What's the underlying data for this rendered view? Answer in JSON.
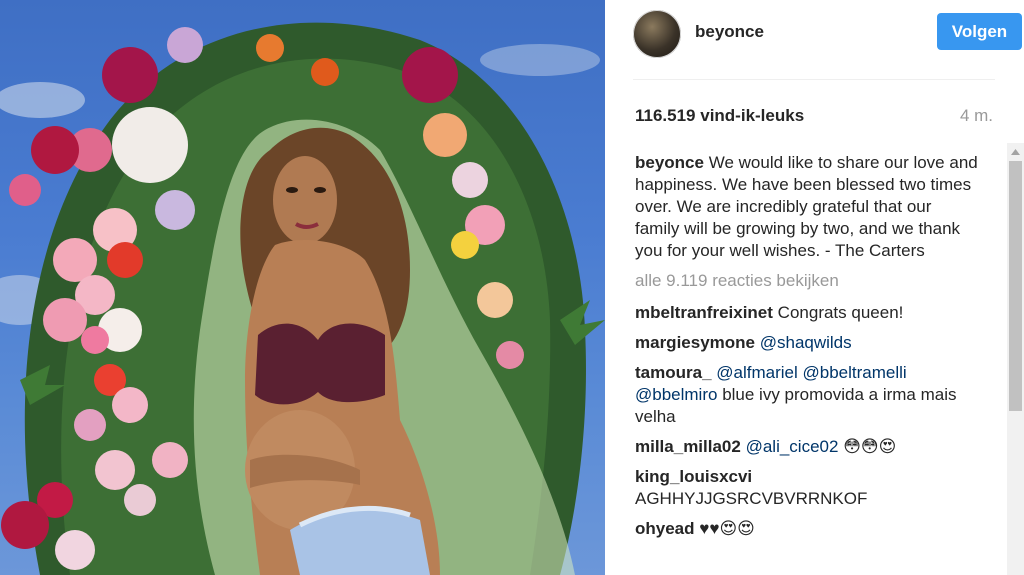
{
  "post": {
    "username": "beyonce",
    "follow_label": "Volgen",
    "likes": "116.519 vind-ik-leuks",
    "age": "4 m.",
    "caption_author": "beyonce",
    "caption_text": "We would like to share our love and happiness. We have been blessed two times over. We are incredibly grateful that our family will be growing by two, and we thank you for your well wishes. - The Carters",
    "view_all": "alle 9.119 reacties bekijken"
  },
  "comments": [
    {
      "author": "mbeltranfreixinet",
      "text": "Congrats queen!"
    },
    {
      "author": "margiesymone",
      "mention": "@shaqwilds",
      "text": ""
    },
    {
      "author": "tamoura_",
      "mention": "@alfmariel @bbeltramelli @bbelmiro",
      "text": "blue ivy promovida a irma mais velha"
    },
    {
      "author": "milla_milla02",
      "mention": "@ali_cice02",
      "text": "😳😳😍"
    },
    {
      "author": "king_louisxcvi",
      "text": "AGHHYJJGSRCVBVRRNKOF"
    },
    {
      "author": "ohyead",
      "text": "♥♥😍😍"
    }
  ],
  "colors": {
    "accent": "#3897f0",
    "mention": "#003569",
    "muted": "#999999"
  }
}
